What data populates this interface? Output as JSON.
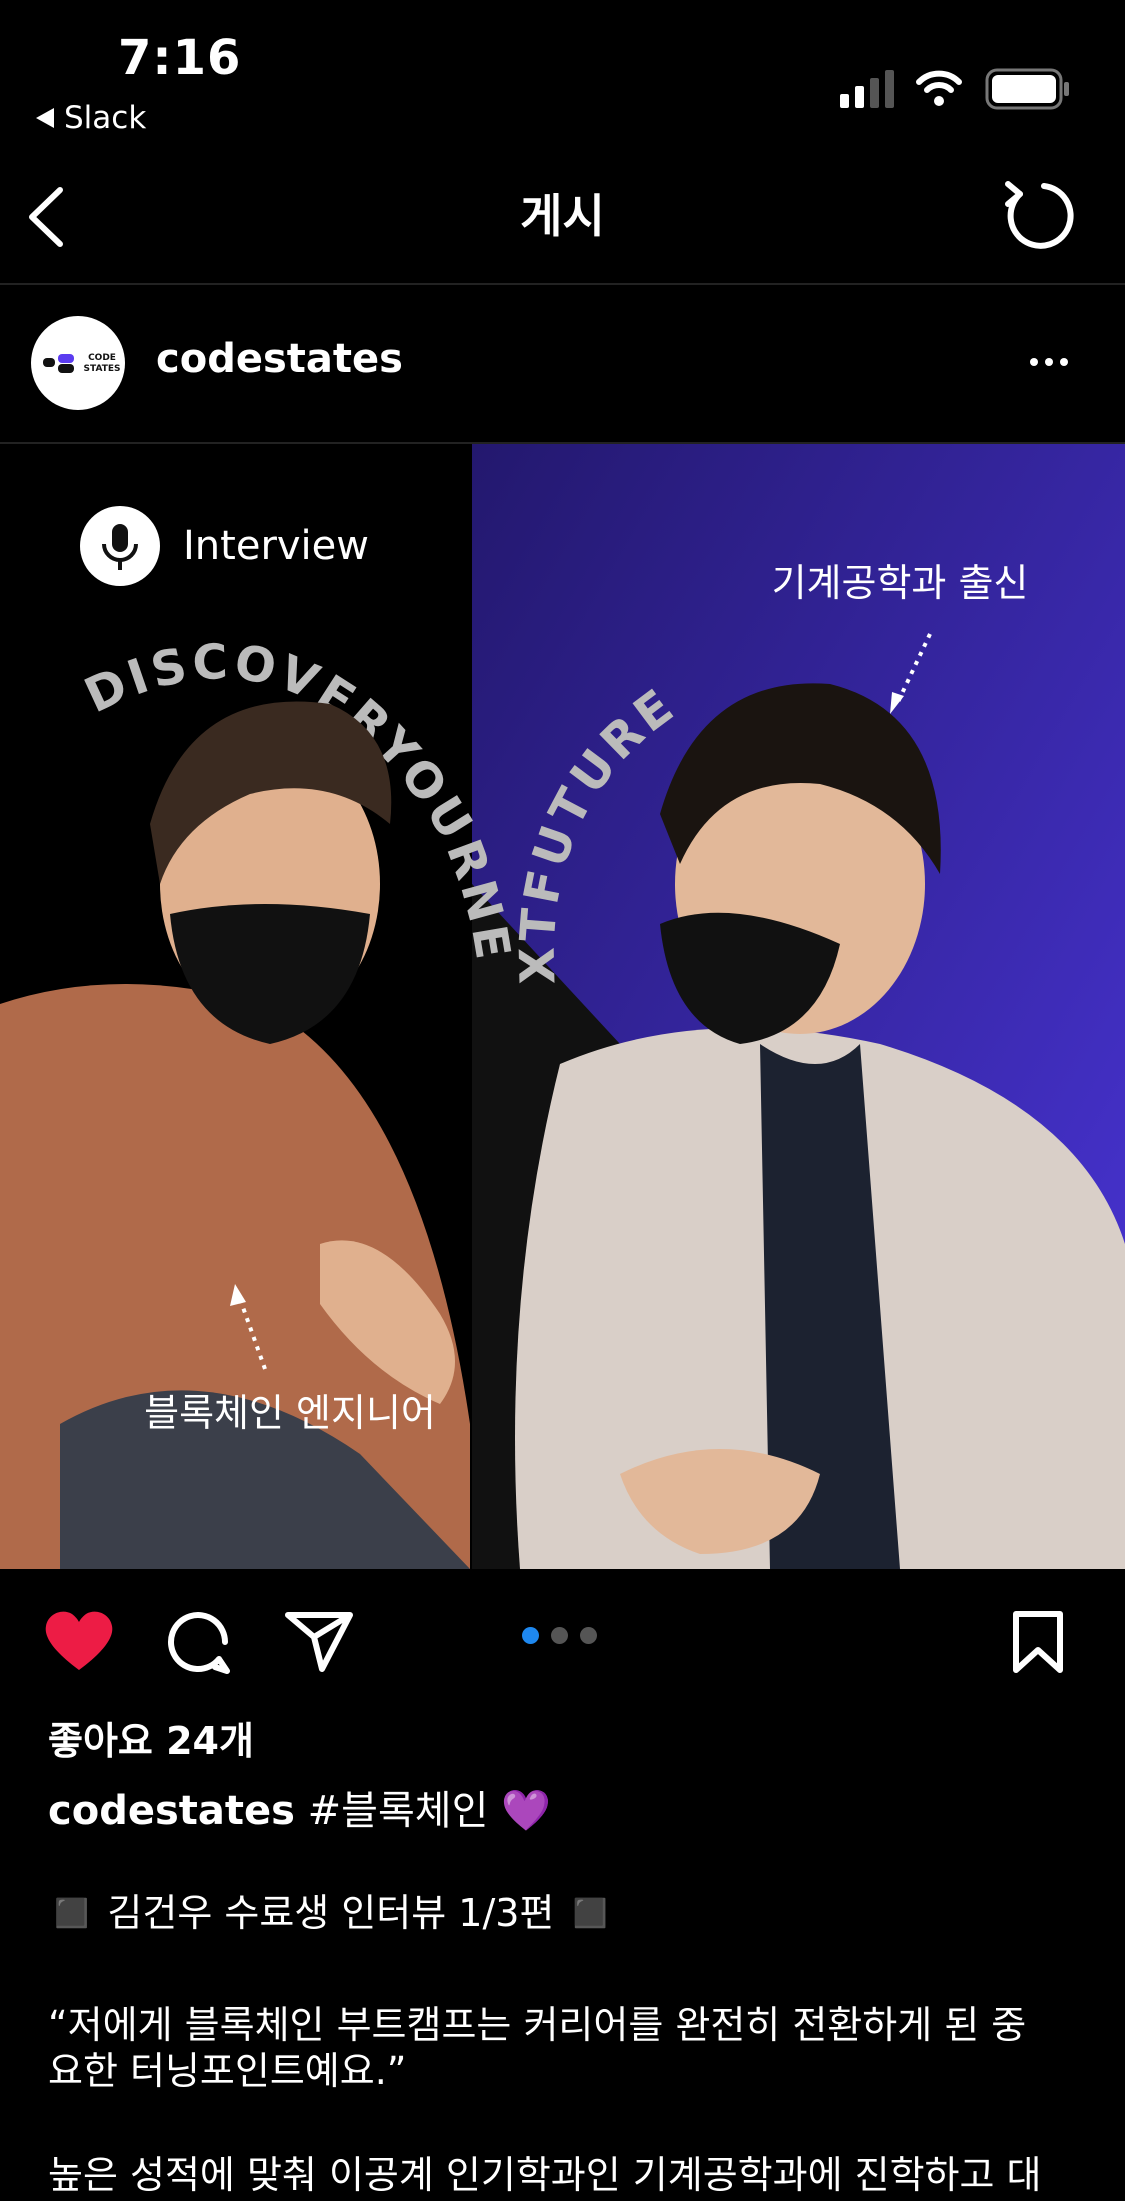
{
  "status_bar": {
    "time": "7:16",
    "back_app": "Slack"
  },
  "nav": {
    "title": "게시"
  },
  "post": {
    "username": "codestates",
    "avatar_text_top": "CODE",
    "avatar_text_bottom": "STATES",
    "image": {
      "badge": "Interview",
      "arc_text_left": "DISCOVERYOURNE",
      "arc_text_right": "XTFUTURE",
      "label_left": "블록체인 엔지니어",
      "label_right": "기계공학과 출신"
    },
    "carousel": {
      "count": 3,
      "active_index": 0
    },
    "likes": "좋아요 24개",
    "caption_user": "codestates",
    "caption_tag": "#블록체인",
    "caption_emoji": "💜",
    "lines": [
      "◼️ 김건우 수료생 인터뷰 1/3편 ◼️",
      "“저에게 블록체인 부트캠프는 커리어를 완전히 전환하게 된 중",
      "요한 터닝포인트예요.”",
      "높은 성적에 맞춰 이공계 인기학과인 기계공학과에 진학하고 대"
    ]
  },
  "colors": {
    "like": "#ed1c45",
    "carousel_active": "#1e88f0",
    "gradient_start": "#2b1c8a",
    "gradient_end": "#4a35d9"
  }
}
